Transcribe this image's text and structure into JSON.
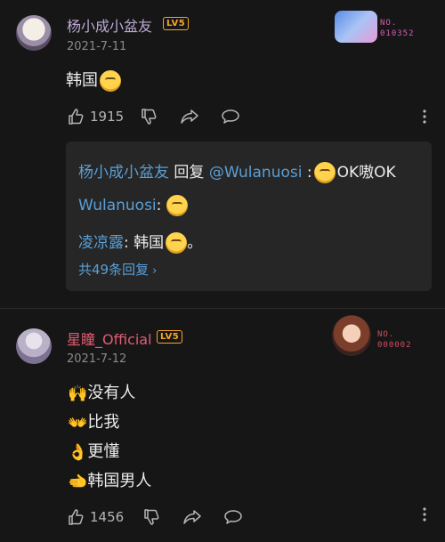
{
  "comments": [
    {
      "username": "杨小成小盆友",
      "level": "LV5",
      "date": "2021-7-11",
      "badge_no": "NO.\n010352",
      "content": "韩国",
      "likes": "1915",
      "replies": {
        "r1_user": "杨小成小盆友",
        "r1_reply_word": "回复",
        "r1_target": "@Wulanuosi",
        "r1_sep": ":",
        "r1_text": "OK嗷OK",
        "r2_user": "Wulanuosi",
        "r2_sep": ":",
        "r3_user": "凌凉露",
        "r3_sep": ":",
        "r3_text": "韩国",
        "r3_end": "。",
        "more": "共49条回复"
      }
    },
    {
      "username": "星瞳_Official",
      "level": "LV5",
      "date": "2021-7-12",
      "badge_no": "NO.\n000002",
      "lines": [
        {
          "emoji": "🙌",
          "text": "没有人"
        },
        {
          "emoji": "👐",
          "text": "比我"
        },
        {
          "emoji": "👌",
          "text": "更懂"
        },
        {
          "emoji": "🫲",
          "text": "韩国男人"
        }
      ],
      "likes": "1456"
    }
  ],
  "colors": {
    "background": "#161616",
    "link_blue": "#5a9fd6",
    "level_orange": "#f5a623",
    "vip_name_pink": "#e25c73"
  }
}
